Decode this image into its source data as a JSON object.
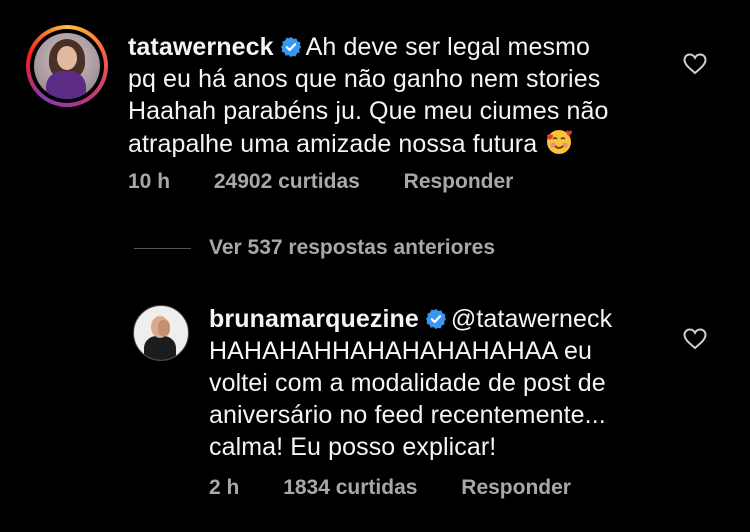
{
  "comment1": {
    "username": "tatawerneck",
    "lines": [
      "Ah deve ser legal mesmo",
      "pq eu há anos que não ganho nem stories",
      "Haahah parabéns ju. Que meu ciumes não",
      "atrapalhe uma amizade nossa futura"
    ],
    "emoji": "smiling-face-with-hearts",
    "time": "10 h",
    "likes": "24902 curtidas",
    "reply": "Responder"
  },
  "view_more": "Ver 537 respostas anteriores",
  "comment2": {
    "username": "brunamarquezine",
    "mention": "@tatawerneck",
    "lines": [
      "HAHAHAHHAHAHAHAHAHAA eu",
      "voltei com a modalidade de post de",
      "aniversário no feed recentemente...",
      "calma! Eu posso explicar!"
    ],
    "time": "2 h",
    "likes": "1834 curtidas",
    "reply": "Responder"
  },
  "colors": {
    "background": "#000000",
    "text": "#f5f5f5",
    "muted": "#a8a8a8",
    "verified": "#3897f0"
  }
}
